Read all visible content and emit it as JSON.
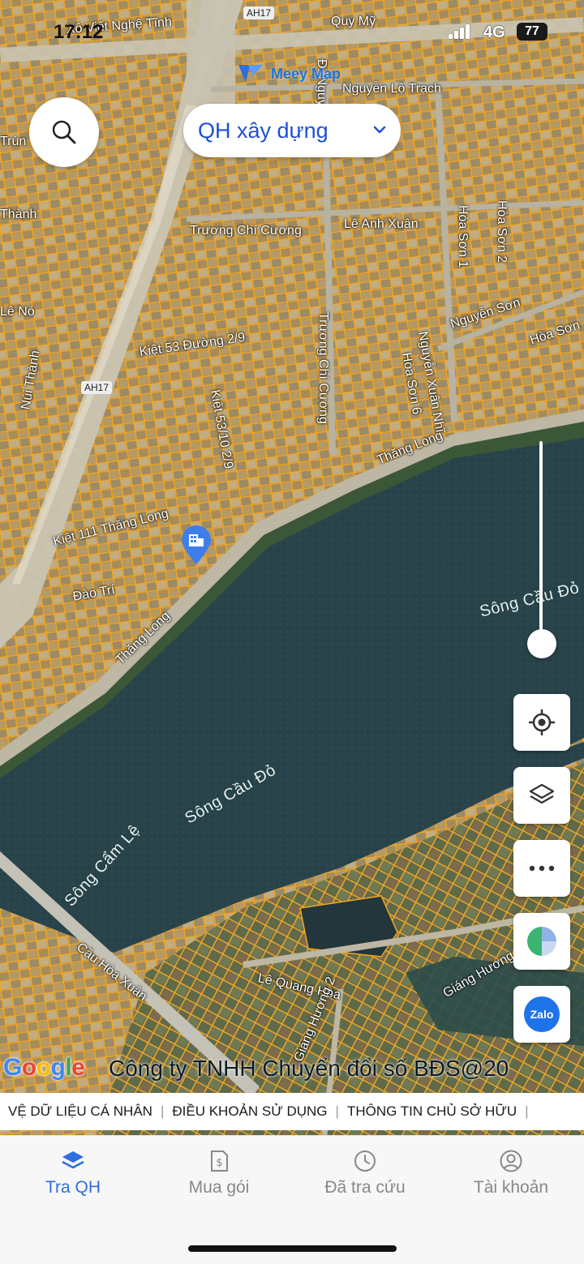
{
  "status_bar": {
    "time": "17:12",
    "network": "4G",
    "battery": "77"
  },
  "brand": {
    "name": "Meey Map"
  },
  "search": {
    "icon": "search-icon"
  },
  "plan_selector": {
    "label": "QH xây dựng",
    "icon": "chevron-down-icon"
  },
  "map": {
    "streets": [
      "Quy Mỹ",
      "Xô Viết Nghệ Tĩnh",
      "AH17",
      "Nguyễn Lộ Trạch",
      "Trương Chí Cương",
      "Lê Anh Xuân",
      "Hòa Sơn 1",
      "Hòa Sơn 2",
      "Nguyễn Sơn",
      "Hòa Sơn",
      "Kiệt 53 Đường 2/9",
      "Kiệt 53/10 2/9",
      "Núi Thành",
      "Thăng Long",
      "Kiệt 111 Thăng Long",
      "Đào Trí",
      "Lê Quang Hòa",
      "Giáng Hương 2",
      "Giáng Hương",
      "Cầu Hòa Xuân",
      "Hòa Sơn 6",
      "Nguyễn Xuân Nhĩ",
      "Trùn",
      "Thành",
      "Lê Nó",
      "Đ. Nguyễn"
    ],
    "rivers": [
      "Sông Cầu Đỏ",
      "Sông Cẩm Lệ"
    ],
    "marker_icon": "building-pin-icon",
    "zoom_level_fraction": 0.2
  },
  "actions": {
    "locate": "crosshair-icon",
    "layers": "layers-icon",
    "more": "more-icon",
    "stats": "pie-chart-icon",
    "zalo_label": "Zalo"
  },
  "attribution": {
    "google": [
      "G",
      "o",
      "o",
      "g",
      "l",
      "e"
    ],
    "copyright": "Công ty TNHH Chuyển đổi số BĐS@20"
  },
  "legal_links": [
    "VỆ DỮ LIỆU CÁ NHÂN",
    "ĐIỀU KHOẢN SỬ DỤNG",
    "THÔNG TIN CHỦ SỞ HỮU"
  ],
  "nav": {
    "tabs": [
      {
        "label": "Tra QH",
        "icon": "layers-icon",
        "active": true
      },
      {
        "label": "Mua gói",
        "icon": "invoice-icon",
        "active": false
      },
      {
        "label": "Đã tra cứu",
        "icon": "clock-icon",
        "active": false
      },
      {
        "label": "Tài khoản",
        "icon": "user-icon",
        "active": false
      }
    ]
  },
  "colors": {
    "accent": "#2d6fe0",
    "parcel": "#f5a623",
    "water": "#263f47",
    "land": "#6d6a5a"
  }
}
